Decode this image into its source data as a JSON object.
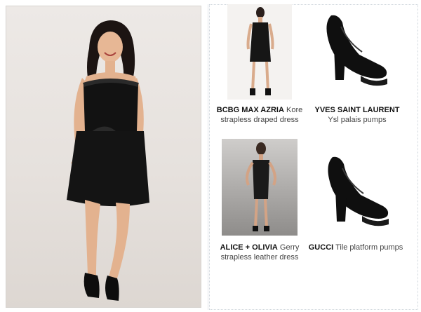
{
  "hero": {
    "image": "model-in-black-strapless-dress"
  },
  "products": [
    {
      "brand": "BCBG MAX AZRIA",
      "name": "Kore strapless draped dress",
      "image": "dress-photo"
    },
    {
      "brand": "YVES SAINT LAURENT",
      "name": "Ysl palais pumps",
      "image": "pumps-photo"
    },
    {
      "brand": "ALICE + OLIVIA",
      "name": "Gerry strapless leather dress",
      "image": "dress-photo"
    },
    {
      "brand": "GUCCI",
      "name": "Tile platform pumps",
      "image": "pumps-photo"
    }
  ],
  "colors": {
    "accent_border": "#cfd6dc",
    "caption_text": "#444444"
  }
}
